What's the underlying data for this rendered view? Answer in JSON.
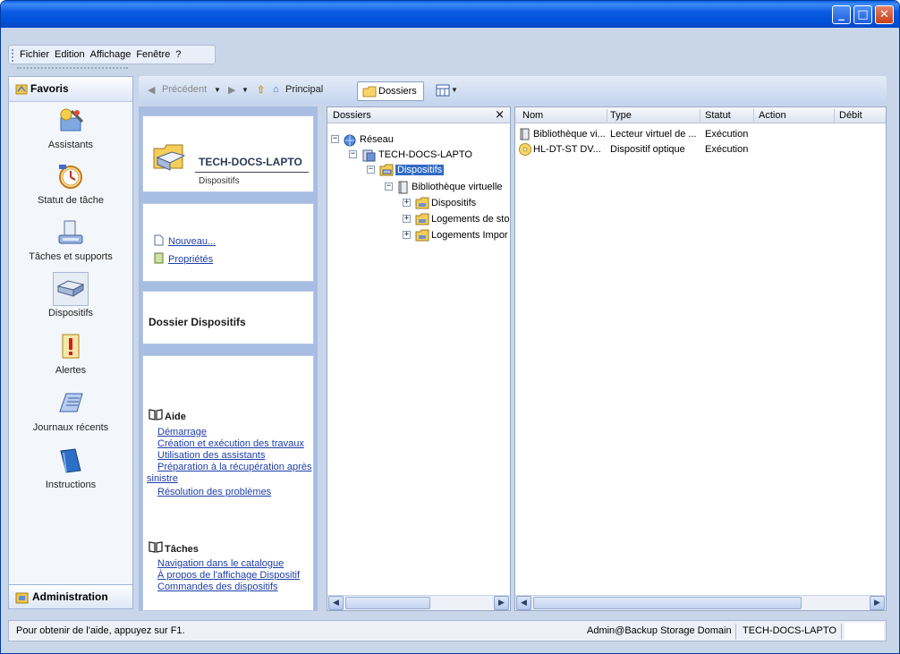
{
  "menu": {
    "items": [
      "Fichier",
      "Edition",
      "Affichage",
      "Fenêtre",
      "?"
    ]
  },
  "nav": {
    "header": "Favoris",
    "items": [
      {
        "label": "Assistants",
        "icon": "wizard-icon"
      },
      {
        "label": "Statut de tâche",
        "icon": "task-status-clock-icon"
      },
      {
        "label": "Tâches et supports",
        "icon": "tasks-media-icon"
      },
      {
        "label": "Dispositifs",
        "icon": "device-drive-icon"
      },
      {
        "label": "Alertes",
        "icon": "alert-icon"
      },
      {
        "label": "Journaux récents",
        "icon": "recent-logs-icon"
      },
      {
        "label": "Instructions",
        "icon": "instructions-book-icon"
      }
    ],
    "footer": "Administration"
  },
  "toolbar": {
    "back_label": "Précédent",
    "home_label": "Principal",
    "folders_label": "Dossiers"
  },
  "taskpane": {
    "host_name": "TECH-DOCS-LAPTO",
    "host_sub": "Dispositifs",
    "actions": [
      "Nouveau...",
      "Propriétés"
    ],
    "folder_title": "Dossier Dispositifs",
    "help_title": "Aide",
    "help_links": [
      "Démarrage",
      "Création et exécution des travaux",
      "Utilisation des assistants",
      "Préparation à la récupération après",
      "sinistre",
      "Résolution des problèmes"
    ],
    "tasks_title": "Tâches",
    "task_links": [
      "Navigation dans le catalogue",
      "À propos de l'affichage Dispositif",
      "Commandes des dispositifs"
    ]
  },
  "tree": {
    "header": "Dossiers",
    "close": "×",
    "nodes": [
      "Réseau",
      "TECH-DOCS-LAPTO",
      "Dispositifs",
      "Bibliothèque virtuelle",
      "Dispositifs",
      "Logements de sto",
      "Logements Impor"
    ]
  },
  "list": {
    "columns": [
      "Nom",
      "Type",
      "Statut",
      "Action",
      "Débit"
    ],
    "rows": [
      {
        "nom": "Bibliothèque vi...",
        "type": "Lecteur virtuel de ...",
        "statut": "Exécution"
      },
      {
        "nom": "HL-DT-ST DV...",
        "type": "Dispositif optique",
        "statut": "Exécution"
      }
    ]
  },
  "status": {
    "help_text": "Pour obtenir de l'aide, appuyez sur F1.",
    "user": "Admin@Backup Storage Domain",
    "server": "TECH-DOCS-LAPTO"
  },
  "colors": {
    "titlebar": "#0054e3",
    "selection": "#316ac5",
    "link": "#1d3eaa",
    "taskpane_bg": "#a8bde2"
  }
}
